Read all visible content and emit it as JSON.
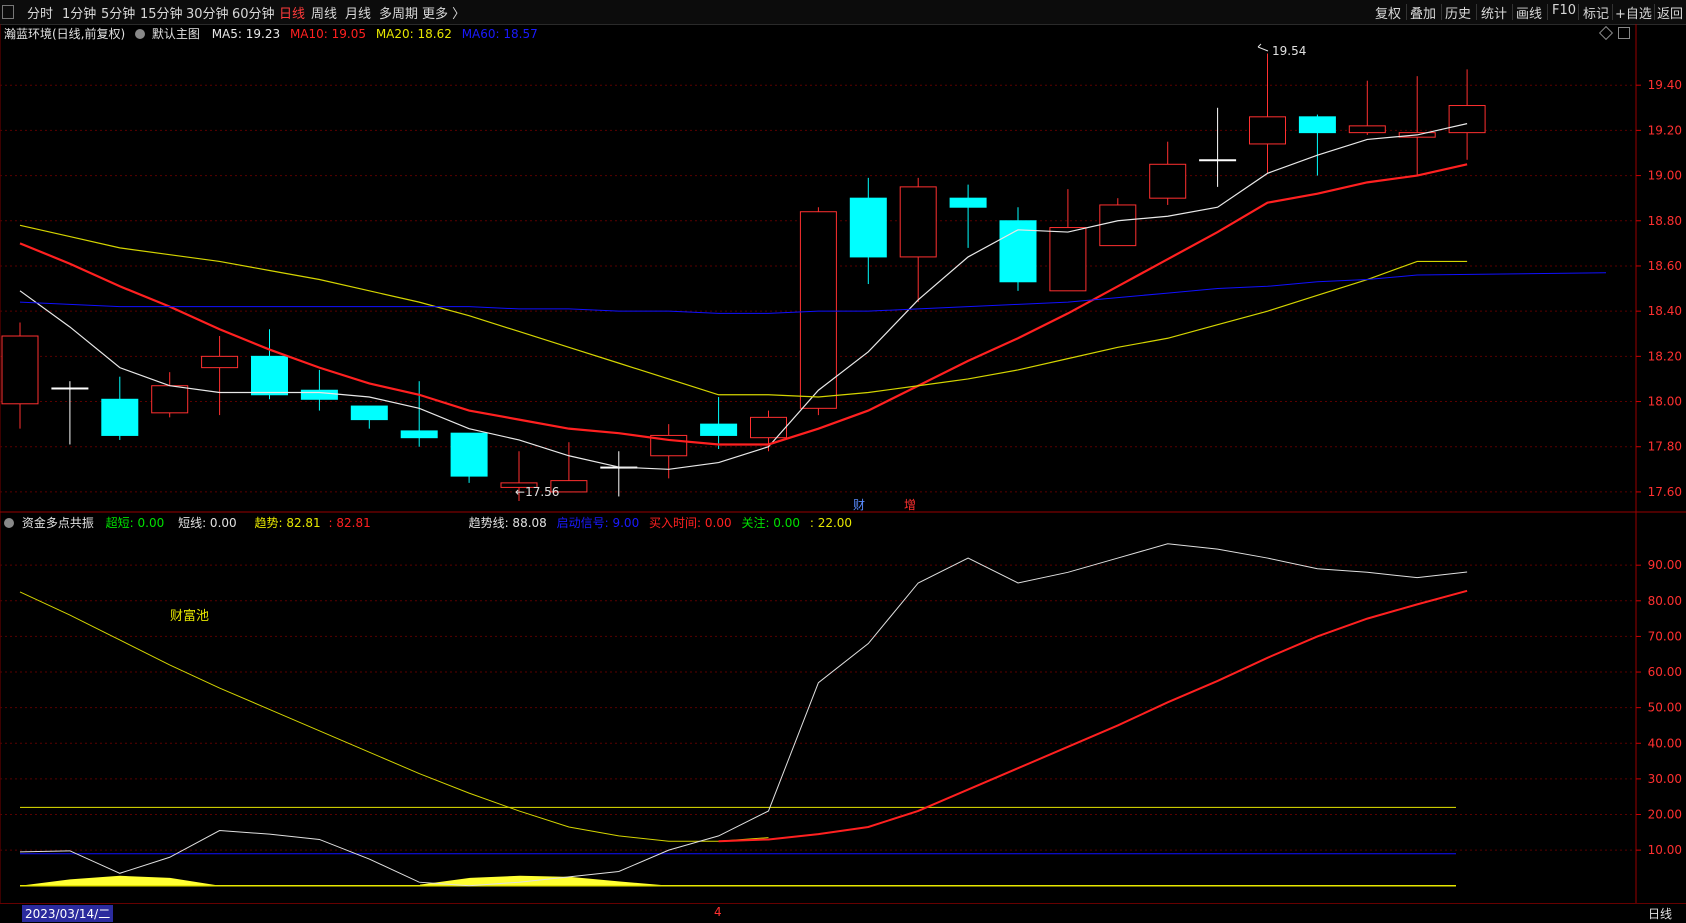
{
  "toolbar": {
    "items": [
      "分时",
      "1分钟",
      "5分钟",
      "15分钟",
      "30分钟",
      "60分钟",
      "日线",
      "周线",
      "月线",
      "多周期",
      "更多 〉"
    ],
    "active_index": 6,
    "right_items": [
      "复权",
      "叠加",
      "历史",
      "统计",
      "画线",
      "F10",
      "+自选",
      "返回"
    ],
    "mark_label": "标记"
  },
  "main_legend": {
    "stock": "瀚蓝环境(日线,前复权)",
    "indicator": "默认主图",
    "ma5": "MA5: 19.23",
    "ma10": "MA10: 19.05",
    "ma20": "MA20: 18.62",
    "ma60": "MA60: 18.57"
  },
  "sub_legend": {
    "name": "资金多点共振",
    "chaoduan": "超短: 0.00",
    "duanxian": "短线: 0.00",
    "qushi": "趋势: 82.81",
    "qushi_val": ": 82.81",
    "qushixian": "趋势线: 88.08",
    "qidong": "启动信号: 9.00",
    "mairu": "买入时间: 0.00",
    "guanzhu": "关注: 0.00",
    "extra": ": 22.00"
  },
  "annotations": {
    "high": "19.54",
    "low": "17.56",
    "cai": "财",
    "zeng": "增",
    "caifuchi": "财富池"
  },
  "footer": {
    "date": "2023/03/14/二",
    "month_marker": "4",
    "period": "日线"
  },
  "colors": {
    "up": "#ff3030",
    "down": "#00ffff",
    "ma5": "#e8e8e8",
    "ma10": "#ff2020",
    "ma20": "#d4d400",
    "ma60": "#1010ff",
    "grid": "#5a0000"
  },
  "chart_data": [
    {
      "type": "candlestick",
      "title": "瀚蓝环境(日线,前复权)",
      "y_ticks": [
        17.6,
        17.8,
        18.0,
        18.2,
        18.4,
        18.6,
        18.8,
        19.0,
        19.2,
        19.4
      ],
      "ylim": [
        17.52,
        19.6
      ],
      "candles": [
        {
          "o": 17.99,
          "h": 18.35,
          "l": 17.88,
          "c": 18.29
        },
        {
          "o": 18.06,
          "h": 18.09,
          "l": 17.81,
          "c": 18.06
        },
        {
          "o": 18.01,
          "h": 18.11,
          "l": 17.83,
          "c": 17.85
        },
        {
          "o": 17.95,
          "h": 18.13,
          "l": 17.93,
          "c": 18.07
        },
        {
          "o": 18.15,
          "h": 18.29,
          "l": 17.94,
          "c": 18.2
        },
        {
          "o": 18.2,
          "h": 18.32,
          "l": 18.01,
          "c": 18.03
        },
        {
          "o": 18.05,
          "h": 18.14,
          "l": 17.96,
          "c": 18.01
        },
        {
          "o": 17.98,
          "h": 17.98,
          "l": 17.88,
          "c": 17.92
        },
        {
          "o": 17.87,
          "h": 18.09,
          "l": 17.8,
          "c": 17.84
        },
        {
          "o": 17.86,
          "h": 17.86,
          "l": 17.64,
          "c": 17.67
        },
        {
          "o": 17.62,
          "h": 17.78,
          "l": 17.56,
          "c": 17.64
        },
        {
          "o": 17.6,
          "h": 17.82,
          "l": 17.6,
          "c": 17.65
        },
        {
          "o": 17.71,
          "h": 17.78,
          "l": 17.58,
          "c": 17.71
        },
        {
          "o": 17.76,
          "h": 17.9,
          "l": 17.66,
          "c": 17.85
        },
        {
          "o": 17.9,
          "h": 18.02,
          "l": 17.79,
          "c": 17.85
        },
        {
          "o": 17.84,
          "h": 17.96,
          "l": 17.78,
          "c": 17.93
        },
        {
          "o": 17.97,
          "h": 18.86,
          "l": 17.94,
          "c": 18.84
        },
        {
          "o": 18.9,
          "h": 18.99,
          "l": 18.52,
          "c": 18.64
        },
        {
          "o": 18.64,
          "h": 18.99,
          "l": 18.44,
          "c": 18.95
        },
        {
          "o": 18.9,
          "h": 18.96,
          "l": 18.68,
          "c": 18.86
        },
        {
          "o": 18.8,
          "h": 18.86,
          "l": 18.49,
          "c": 18.53
        },
        {
          "o": 18.49,
          "h": 18.94,
          "l": 18.49,
          "c": 18.77
        },
        {
          "o": 18.69,
          "h": 18.9,
          "l": 18.69,
          "c": 18.87
        },
        {
          "o": 18.9,
          "h": 19.15,
          "l": 18.87,
          "c": 19.05
        },
        {
          "o": 19.07,
          "h": 19.3,
          "l": 18.95,
          "c": 19.07
        },
        {
          "o": 19.14,
          "h": 19.54,
          "l": 19.01,
          "c": 19.26
        },
        {
          "o": 19.26,
          "h": 19.27,
          "l": 19.0,
          "c": 19.19
        },
        {
          "o": 19.19,
          "h": 19.42,
          "l": 19.18,
          "c": 19.22
        },
        {
          "o": 19.17,
          "h": 19.44,
          "l": 19.0,
          "c": 19.19
        },
        {
          "o": 19.19,
          "h": 19.47,
          "l": 19.07,
          "c": 19.31
        }
      ],
      "series": [
        {
          "name": "MA5",
          "values": [
            18.49,
            18.33,
            18.15,
            18.07,
            18.04,
            18.04,
            18.04,
            18.02,
            17.97,
            17.88,
            17.83,
            17.76,
            17.71,
            17.7,
            17.73,
            17.8,
            18.05,
            18.22,
            18.45,
            18.64,
            18.76,
            18.75,
            18.8,
            18.82,
            18.86,
            19.01,
            19.09,
            19.16,
            19.18,
            19.23
          ]
        },
        {
          "name": "MA10",
          "values": [
            18.7,
            18.61,
            18.51,
            18.42,
            18.32,
            18.23,
            18.15,
            18.08,
            18.03,
            17.96,
            17.92,
            17.88,
            17.86,
            17.83,
            17.81,
            17.81,
            17.88,
            17.96,
            18.07,
            18.18,
            18.28,
            18.39,
            18.51,
            18.63,
            18.75,
            18.88,
            18.92,
            18.97,
            19.0,
            19.05
          ]
        },
        {
          "name": "MA20",
          "values": [
            18.78,
            18.73,
            18.68,
            18.65,
            18.62,
            18.58,
            18.54,
            18.49,
            18.44,
            18.38,
            18.31,
            18.24,
            18.17,
            18.1,
            18.03,
            18.03,
            18.02,
            18.04,
            18.07,
            18.1,
            18.14,
            18.19,
            18.24,
            18.28,
            18.34,
            18.4,
            18.47,
            18.54,
            18.62,
            18.62
          ]
        },
        {
          "name": "MA60",
          "values": [
            18.44,
            18.43,
            18.42,
            18.42,
            18.42,
            18.42,
            18.42,
            18.42,
            18.42,
            18.42,
            18.41,
            18.41,
            18.4,
            18.4,
            18.39,
            18.39,
            18.4,
            18.4,
            18.41,
            18.42,
            18.43,
            18.44,
            18.46,
            18.48,
            18.5,
            18.51,
            18.53,
            18.54,
            18.56,
            18.57
          ]
        }
      ]
    },
    {
      "type": "line",
      "title": "资金多点共振",
      "y_ticks": [
        10,
        20,
        30,
        40,
        50,
        60,
        70,
        80,
        90
      ],
      "ylim": [
        -4,
        101
      ],
      "series": [
        {
          "name": "趋势线",
          "values": [
            9.5,
            9.8,
            3.5,
            8,
            15.5,
            14.5,
            13,
            7.5,
            1,
            0,
            1,
            2.5,
            4,
            10,
            14,
            21,
            57,
            68,
            85,
            92,
            85,
            88,
            92,
            96,
            94.5,
            92,
            89,
            88,
            86.5,
            88.08
          ]
        },
        {
          "name": "趋势",
          "values": [
            null,
            null,
            null,
            null,
            null,
            null,
            null,
            null,
            null,
            null,
            null,
            null,
            null,
            null,
            null,
            12.5,
            13,
            14.5,
            16.5,
            21,
            27,
            33,
            39,
            45,
            51.5,
            57.5,
            64,
            70,
            75,
            79,
            82.81
          ]
        },
        {
          "name": "",
          "values": [
            82.5,
            76,
            69,
            62,
            55.5,
            49.5,
            43.5,
            37.5,
            31.5,
            26,
            21,
            16.5,
            14,
            12.5,
            12.5,
            13.5
          ]
        },
        {
          "name": "启动信号",
          "values": [
            9,
            9
          ]
        },
        {
          "name": "",
          "values": [
            22,
            22
          ]
        },
        {
          "name": "",
          "values": [
            0,
            1.8,
            2.8,
            2.2,
            0,
            0,
            0,
            0,
            0,
            0.3,
            2.2,
            2.8,
            2.5,
            1.2,
            0
          ]
        }
      ]
    }
  ]
}
